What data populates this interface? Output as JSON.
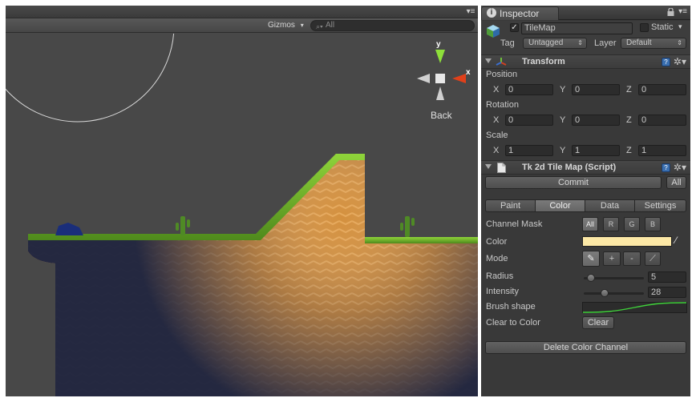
{
  "scene": {
    "gizmos_label": "Gizmos",
    "search_placeholder": "All",
    "orientation_label": "Back",
    "axis_x": "x",
    "axis_y": "y"
  },
  "inspector": {
    "tab_label": "Inspector",
    "object": {
      "name": "TileMap",
      "active": true,
      "static_label": "Static",
      "static": false,
      "tag_label": "Tag",
      "tag_value": "Untagged",
      "layer_label": "Layer",
      "layer_value": "Default"
    },
    "transform": {
      "title": "Transform",
      "position_label": "Position",
      "rotation_label": "Rotation",
      "scale_label": "Scale",
      "x_label": "X",
      "y_label": "Y",
      "z_label": "Z",
      "position": [
        "0",
        "0",
        "0"
      ],
      "rotation": [
        "0",
        "0",
        "0"
      ],
      "scale": [
        "1",
        "1",
        "1"
      ]
    },
    "tilemap": {
      "title": "Tk 2d Tile Map (Script)",
      "commit_label": "Commit",
      "all_label": "All",
      "tabs": [
        "Paint",
        "Color",
        "Data",
        "Settings"
      ],
      "active_tab": "Color",
      "channel_mask_label": "Channel Mask",
      "channel_buttons": [
        "All",
        "R",
        "G",
        "B"
      ],
      "color_label": "Color",
      "color_value": "#fce8a6",
      "mode_label": "Mode",
      "mode_plus": "+",
      "mode_minus": "-",
      "radius_label": "Radius",
      "radius_value": "5",
      "radius_fraction": 0.05,
      "intensity_label": "Intensity",
      "intensity_value": "28",
      "intensity_fraction": 0.28,
      "brush_shape_label": "Brush shape",
      "clear_to_color_label": "Clear to Color",
      "clear_label": "Clear",
      "delete_channel_label": "Delete Color Channel"
    }
  }
}
